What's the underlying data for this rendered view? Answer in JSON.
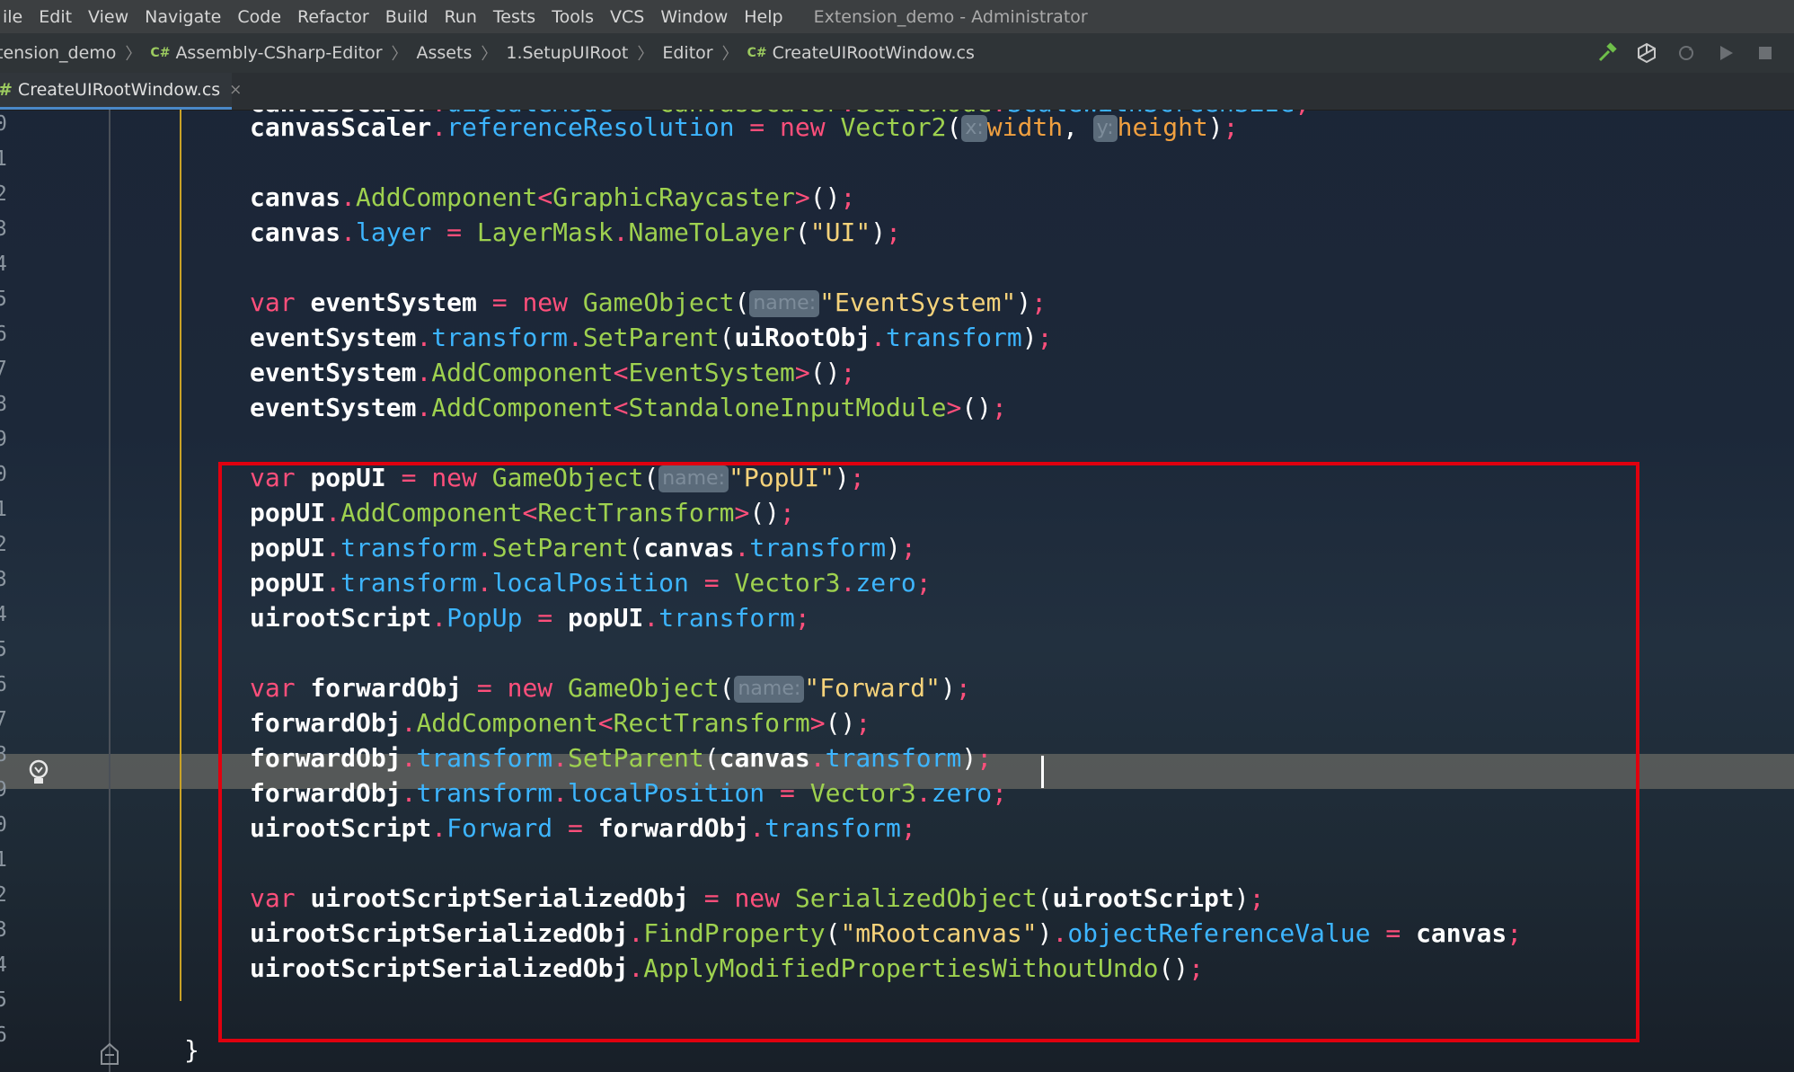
{
  "menu": {
    "items": [
      "ile",
      "Edit",
      "View",
      "Navigate",
      "Code",
      "Refactor",
      "Build",
      "Run",
      "Tests",
      "Tools",
      "VCS",
      "Window",
      "Help"
    ],
    "window_title": "Extension_demo - Administrator"
  },
  "breadcrumb": {
    "project": "tension_demo",
    "assembly_badge": "C#",
    "assembly": "Assembly-CSharp-Editor",
    "folder1": "Assets",
    "folder2": "1.SetupUIRoot",
    "folder3": "Editor",
    "file_badge": "C#",
    "file": "CreateUIRootWindow.cs"
  },
  "toolbar": {
    "icons": [
      "hammer-icon",
      "unity-icon",
      "refresh-icon",
      "run-icon",
      "stop-icon"
    ],
    "hammer_color": "#6fbf4a"
  },
  "tab": {
    "hash": "#",
    "label": "CreateUIRootWindow.cs",
    "close": "×"
  },
  "gutter": {
    "line_numbers": [
      "0",
      "1",
      "2",
      "3",
      "4",
      "5",
      "6",
      "7",
      "8",
      "9",
      "0",
      "1",
      "2",
      "3",
      "4",
      "5",
      "6",
      "7",
      "8",
      "9",
      "0",
      "1",
      "2",
      "3",
      "4",
      "5",
      "6"
    ],
    "partial_top": "9"
  },
  "code": {
    "partial_line": "canvasScaler.uiScaleMode = CanvasScaler.ScaleMode.ScaleWithScreenSize;",
    "hint_x": "x:",
    "hint_y": "y:",
    "hint_name": "name:",
    "closing_brace": "}"
  },
  "colors": {
    "keyword": "#ff4f7b",
    "field": "#3db5ff",
    "type": "#9ed14f",
    "string": "#f5d27a",
    "highlight_box": "#e0000f"
  }
}
